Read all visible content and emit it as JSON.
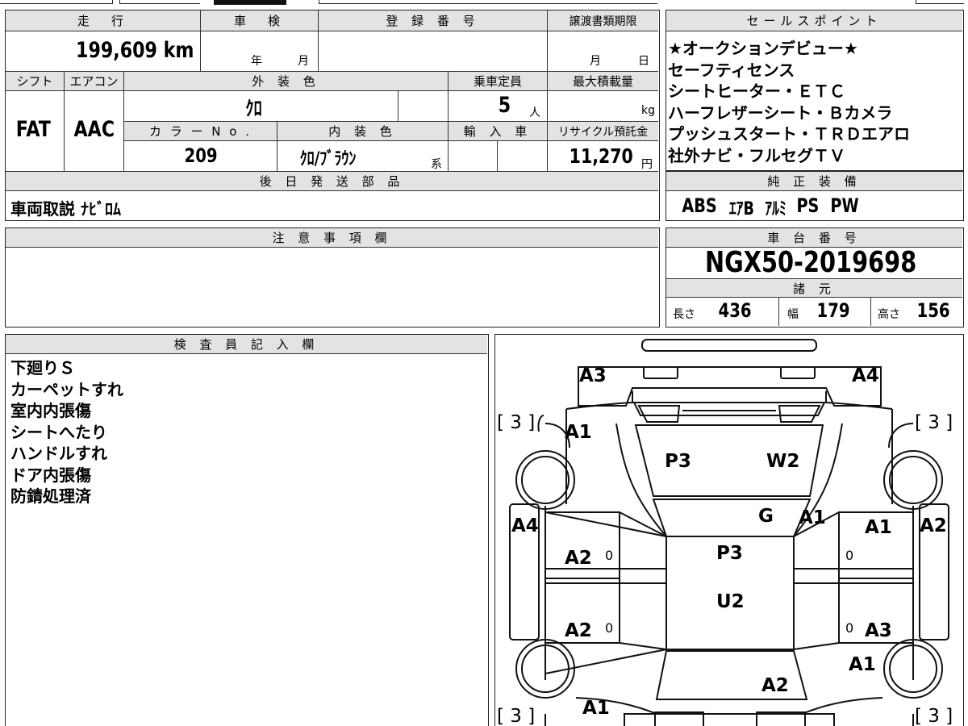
{
  "top": {
    "mileage_label": "走　行",
    "mileage_value": "199,609 km",
    "inspection_label": "車　検",
    "inspection_year": "年",
    "inspection_month": "月",
    "reg_no_label": "登 録 番 号",
    "transfer_label": "譲渡書類期限",
    "transfer_month": "月",
    "transfer_day": "日",
    "shift_label": "シフト",
    "shift_value": "FAT",
    "ac_label": "エアコン",
    "ac_value": "AAC",
    "exterior_label": "外 装 色",
    "exterior_value": "ｸﾛ",
    "capacity_label": "乗車定員",
    "capacity_value": "5",
    "capacity_unit": "人",
    "maxload_label": "最大積載量",
    "maxload_unit": "kg",
    "color_no_label": "カ ラ ー N o .",
    "color_no_value": "209",
    "interior_label": "内 装 色",
    "interior_value": "ｸﾛ/ﾌﾞﾗｳﾝ",
    "interior_suffix": "系",
    "import_label": "輸 入 車",
    "recycle_label": "リサイクル預託金",
    "recycle_value": "11,270",
    "recycle_unit": "円",
    "later_parts_label": "後 日 発 送 部 品",
    "later_parts_value": "車両取説 ﾅﾋﾞﾛﾑ"
  },
  "sales": {
    "label": "セールスポイント",
    "lines": [
      "★オークションデビュー★",
      "セーフティセンス",
      "シートヒーター・ＥＴＣ",
      "ハーフレザーシート・Ｂカメラ",
      "プッシュスタート・ＴＲＤエアロ",
      "社外ナビ・フルセグＴＶ"
    ]
  },
  "equipment": {
    "label": "純 正 装 備",
    "items": [
      "ABS",
      "ｴｱB",
      "ｱﾙﾐ",
      "PS",
      "PW"
    ]
  },
  "notes": {
    "label": "注 意 事 項 欄",
    "value": ""
  },
  "chassis": {
    "label": "車 台 番 号",
    "value": "NGX50-2019698"
  },
  "specs": {
    "label": "諸 元",
    "length_label": "長さ",
    "length_value": "436",
    "width_label": "幅",
    "width_value": "179",
    "height_label": "高さ",
    "height_value": "156"
  },
  "inspector": {
    "label": "検 査 員 記 入 欄",
    "lines": [
      "下廻りＳ",
      "カーペットすれ",
      "室内内張傷",
      "シートへたり",
      "ハンドルすれ",
      "ドア内張傷",
      "防錆処理済"
    ]
  },
  "diagram": {
    "marks": {
      "rear_left": "A3",
      "rear_right": "A4",
      "bracket_tl": "[ 3 ]",
      "bracket_tr": "[ 3 ]",
      "bracket_bl": "[ 3 ]",
      "bracket_br": "[ 3 ]",
      "quarter_left": "A1",
      "rear_glass_left": "P3",
      "rear_glass_right": "W2",
      "roof_g": "G",
      "roof_a1": "A1",
      "side_left_a4": "A4",
      "side_right_a2": "A2",
      "rear_door_left": "A2",
      "rear_door_right": "A1",
      "roof_p3": "P3",
      "roof_u2": "U2",
      "front_door_left": "A2",
      "front_door_right": "A3",
      "fender_right": "A1",
      "hood": "A2",
      "front_left": "A1",
      "zero": "0"
    }
  }
}
